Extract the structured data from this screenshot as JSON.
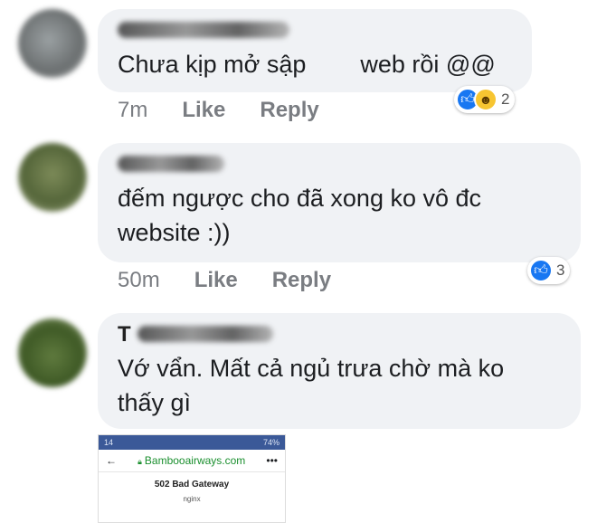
{
  "comments": [
    {
      "author_initial": "",
      "text": "Chưa kịp mở sập        web rồi @@",
      "time": "7m",
      "like_label": "Like",
      "reply_label": "Reply",
      "reaction_count": "2",
      "reactions": [
        "like-icon",
        "haha-icon"
      ]
    },
    {
      "author_initial": "",
      "text": "đếm ngược cho đã xong ko vô đc\nwebsite :))",
      "time": "50m",
      "like_label": "Like",
      "reply_label": "Reply",
      "reaction_count": "3",
      "reactions": [
        "like-icon"
      ]
    },
    {
      "author_initial": "T",
      "text": "Vớ vẩn. Mất cả ngủ trưa chờ mà ko\nthấy gì"
    }
  ],
  "attachment": {
    "status_left": "14",
    "status_right": "74%",
    "url": "Bambooairways.com",
    "menu": "•••",
    "back": "←",
    "page_title": "502 Bad Gateway",
    "page_sub": "nginx"
  },
  "colors": {
    "bubble": "#f0f2f5",
    "like_blue": "#1877f2",
    "meta_gray": "#7a7d82"
  }
}
